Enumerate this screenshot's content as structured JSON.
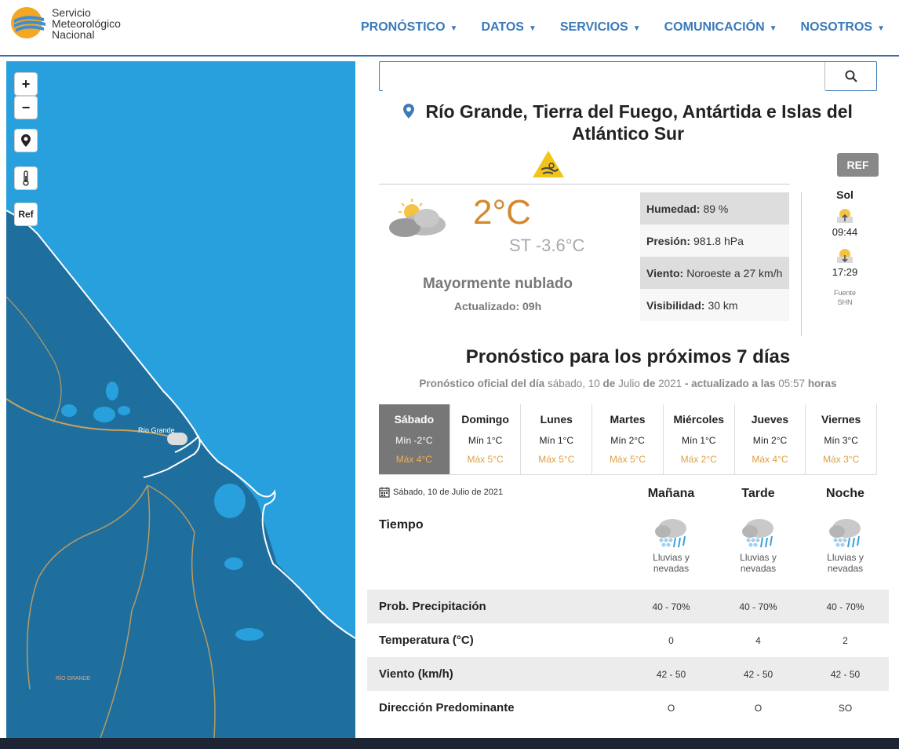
{
  "header": {
    "logo_lines": [
      "Servicio",
      "Meteorológico",
      "Nacional"
    ],
    "nav": [
      {
        "label": "PRONÓSTICO"
      },
      {
        "label": "DATOS"
      },
      {
        "label": "SERVICIOS"
      },
      {
        "label": "COMUNICACIÓN"
      },
      {
        "label": "NOSOTROS"
      }
    ]
  },
  "map": {
    "zoom_in": "+",
    "zoom_out": "−",
    "ref_button": "Ref",
    "city_label": "Río Grande",
    "region_label": "RÍO GRANDE"
  },
  "search": {
    "placeholder": "",
    "value": ""
  },
  "location": {
    "title": "Río Grande, Tierra del Fuego, Antártida e Islas del Atlántico Sur",
    "ref_label": "REF"
  },
  "current": {
    "temp": "2°C",
    "st": "ST -3.6°C",
    "condition": "Mayormente nublado",
    "updated": "Actualizado: 09h",
    "details": [
      {
        "label": "Humedad:",
        "value": "89 %"
      },
      {
        "label": "Presión:",
        "value": "981.8 hPa"
      },
      {
        "label": "Viento:",
        "value": "Noroeste a 27 km/h"
      },
      {
        "label": "Visibilidad:",
        "value": "30 km"
      }
    ],
    "sun": {
      "title": "Sol",
      "sunrise": "09:44",
      "sunset": "17:29",
      "source_label": "Fuente",
      "source": "SHN"
    }
  },
  "forecast": {
    "title": "Pronóstico para los próximos 7 días",
    "subtitle_a": "Pronóstico oficial del día",
    "subtitle_day": "sábado, 10",
    "subtitle_b": "de",
    "subtitle_month": "Julio",
    "subtitle_c": "de",
    "subtitle_year": "2021",
    "subtitle_d": "- actualizado a las",
    "subtitle_time": "05:57",
    "subtitle_e": "horas",
    "days": [
      {
        "name": "Sábado",
        "min": "Mín -2°C",
        "max": "Máx 4°C"
      },
      {
        "name": "Domingo",
        "min": "Mín 1°C",
        "max": "Máx 5°C"
      },
      {
        "name": "Lunes",
        "min": "Mín 1°C",
        "max": "Máx 5°C"
      },
      {
        "name": "Martes",
        "min": "Mín 2°C",
        "max": "Máx 5°C"
      },
      {
        "name": "Miércoles",
        "min": "Mín 1°C",
        "max": "Máx 2°C"
      },
      {
        "name": "Jueves",
        "min": "Mín 2°C",
        "max": "Máx 4°C"
      },
      {
        "name": "Viernes",
        "min": "Mín 3°C",
        "max": "Máx 3°C"
      }
    ],
    "date": "Sábado, 10 de Julio de 2021",
    "periods": [
      "Mañana",
      "Tarde",
      "Noche"
    ],
    "tiempo_label": "Tiempo",
    "weather": [
      {
        "line1": "Lluvias y",
        "line2": "nevadas"
      },
      {
        "line1": "Lluvias y",
        "line2": "nevadas"
      },
      {
        "line1": "Lluvias y",
        "line2": "nevadas"
      }
    ],
    "rows": [
      {
        "label": "Prob. Precipitación",
        "values": [
          "40 - 70%",
          "40 - 70%",
          "40 - 70%"
        ]
      },
      {
        "label": "Temperatura (°C)",
        "values": [
          "0",
          "4",
          "2"
        ]
      },
      {
        "label": "Viento (km/h)",
        "values": [
          "42 - 50",
          "42 - 50",
          "42 - 50"
        ]
      },
      {
        "label": "Dirección Predominante",
        "values": [
          "O",
          "O",
          "SO"
        ]
      }
    ]
  }
}
